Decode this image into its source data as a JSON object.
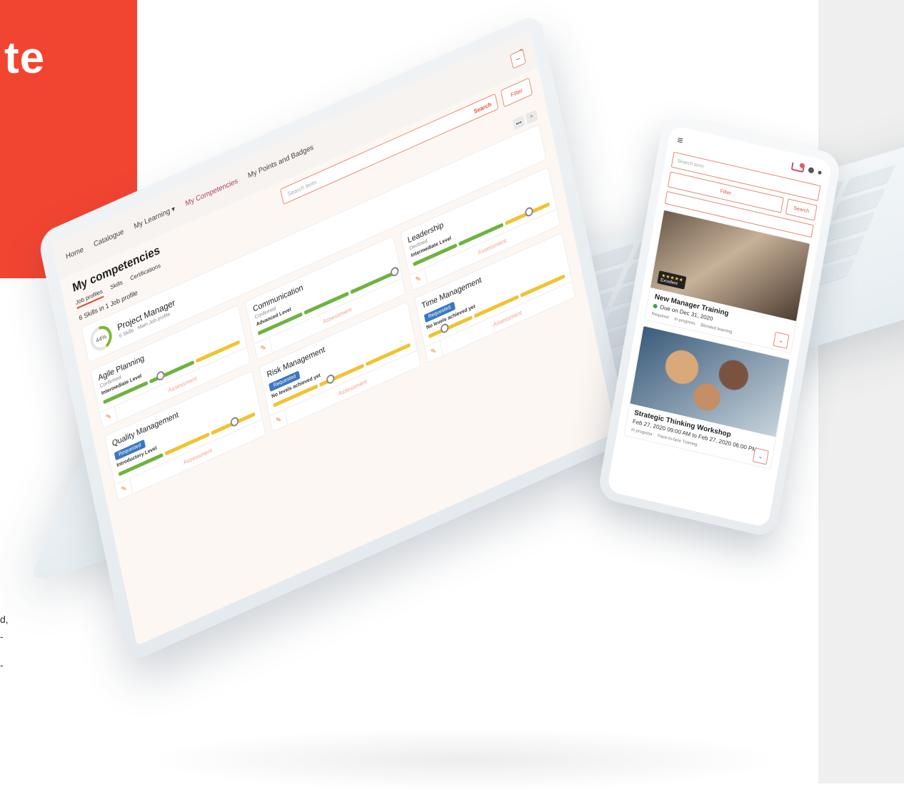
{
  "banner": {
    "text": "te"
  },
  "side_fragments": [
    "d,",
    "-",
    "-"
  ],
  "laptop": {
    "nav": {
      "home": "Home",
      "catalogue": "Catalogue",
      "my_learning": "My Learning ▾",
      "my_competencies": "My Competencies",
      "my_points": "My Points and Badges"
    },
    "page_title": "My competencies",
    "subtabs": [
      "Job profiles",
      "Skills",
      "Certifications"
    ],
    "search": {
      "placeholder": "Search term",
      "button": "Search"
    },
    "filter_label": "Filter",
    "minus_label": "−",
    "skills_count": "6 Skills in 1 Job profile",
    "collapse": {
      "more": "•••",
      "up": "^"
    },
    "profile": {
      "progress": "44%",
      "name": "Project Manager",
      "skills": "6 Skills",
      "main": "Main Job profile"
    },
    "assessment_label": "Assessment",
    "competencies": [
      {
        "name": "Agile Planning",
        "status": "Confirmed",
        "level": "Intermediate Level",
        "filled": 2,
        "dot": 0.42
      },
      {
        "name": "Communication",
        "status": "Confirmed",
        "level": "Advanced Level",
        "filled": 3,
        "dot": 1.0
      },
      {
        "name": "Leadership",
        "status": "Declined",
        "level": "Intermediate Level",
        "filled": 2,
        "dot": 0.85
      },
      {
        "name": "Quality Management",
        "status": "Requested",
        "level": "Introductory Level",
        "filled": 1,
        "dot": 0.85
      },
      {
        "name": "Risk Management",
        "status": "Requested",
        "level": "No levels achieved yet",
        "filled": 0,
        "dot": 0.42
      },
      {
        "name": "Time Management",
        "status": "Requested",
        "level": "No levels achieved yet",
        "filled": 0,
        "dot": 0.12
      }
    ]
  },
  "phone": {
    "hamburger": "≡",
    "search_placeholder": "Search term",
    "filter_label": "Filter",
    "search_button": "Search",
    "chevron": "⌄",
    "courses": [
      {
        "title": "New Manager Training",
        "due": "Due on Dec 31, 2020",
        "rating_stars": "★★★★★",
        "rating_label": "Excellent",
        "meta": [
          "Required",
          "In progress",
          "Blended learning"
        ]
      },
      {
        "title": "Strategic Thinking Workshop",
        "due": "Feb 27, 2020 09:00 AM to Feb 27, 2020 06:00 PM",
        "meta": [
          "In progress",
          "Face-to-face Training"
        ]
      }
    ]
  }
}
